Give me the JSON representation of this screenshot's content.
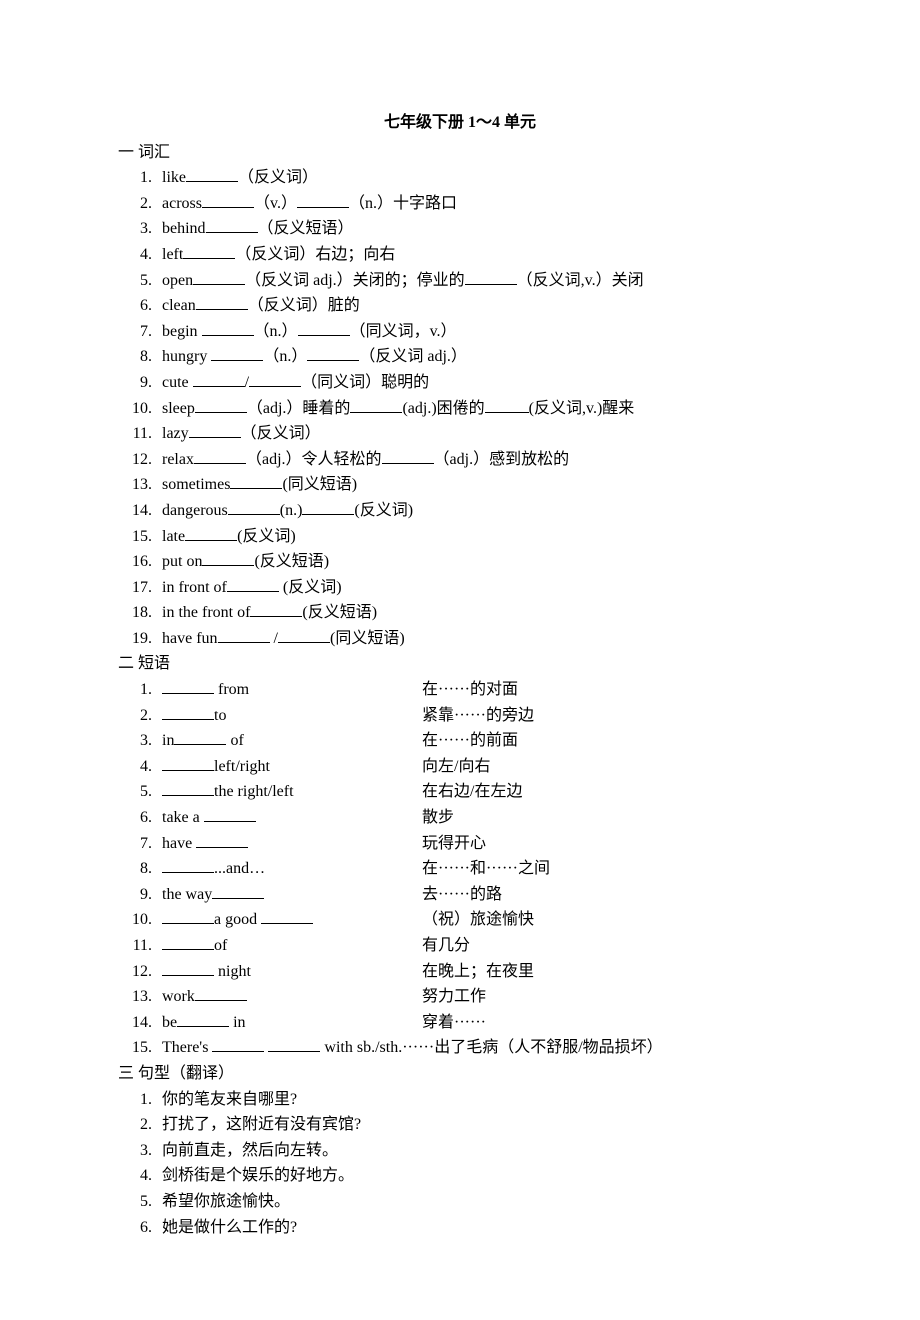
{
  "title": "七年级下册 1～4 单元",
  "sections": {
    "vocab": {
      "head": "一  词汇",
      "items": [
        {
          "pre": "like",
          "rest": "（反义词）"
        },
        {
          "pre": "across",
          "rest": "（v.）",
          "rest2": "（n.）十字路口"
        },
        {
          "pre": "behind",
          "rest": "（反义短语）"
        },
        {
          "pre": "left",
          "rest": "（反义词）右边；向右"
        },
        {
          "pre": "open",
          "rest": "（反义词 adj.）关闭的；停业的",
          "rest2": "（反义词,v.）关闭"
        },
        {
          "pre": "clean",
          "rest": "（反义词）脏的"
        },
        {
          "pre": "begin ",
          "rest": "（n.）",
          "rest2": "（同义词，v.）"
        },
        {
          "pre": "hungry ",
          "rest": "（n.）",
          "rest2": "（反义词 adj.）"
        },
        {
          "pre": "cute ",
          "rest": "/",
          "rest2": "（同义词）聪明的"
        },
        {
          "pre": "sleep",
          "rest": "（adj.）睡着的",
          "rest2": "(adj.)困倦的",
          "rest3": "(反义词,v.)醒来"
        },
        {
          "pre": "lazy",
          "rest": "（反义词）"
        },
        {
          "pre": "relax",
          "rest": "（adj.）令人轻松的",
          "rest2": "（adj.）感到放松的"
        },
        {
          "pre": "sometimes",
          "rest": "(同义短语)"
        },
        {
          "pre": "dangerous",
          "rest": "(n.)",
          "rest2": "(反义词)"
        },
        {
          "pre": "late",
          "rest": "(反义词)"
        },
        {
          "pre": "put on",
          "rest": "(反义短语)"
        },
        {
          "pre": "in front of",
          "rest": " (反义词)"
        },
        {
          "pre": "in the front of",
          "rest": "(反义短语)"
        },
        {
          "pre": "have fun",
          "rest": " /",
          "rest2": "(同义短语)"
        }
      ]
    },
    "phrases": {
      "head": "二  短语",
      "items": [
        {
          "left_pre": "",
          "left_post": " from",
          "right": "在······的对面"
        },
        {
          "left_pre": "",
          "left_post": "to",
          "right": "紧靠······的旁边"
        },
        {
          "left_pre": "in",
          "left_post": " of",
          "right": "在······的前面"
        },
        {
          "left_pre": "",
          "left_post": "left/right",
          "right": "向左/向右"
        },
        {
          "left_pre": "",
          "left_post": "the right/left",
          "right": "在右边/在左边"
        },
        {
          "left_pre": "take a ",
          "left_post": "",
          "right": "散步"
        },
        {
          "left_pre": "have ",
          "left_post": "",
          "right": "玩得开心"
        },
        {
          "left_pre": "",
          "left_post": "...and…",
          "right": "在······和······之间"
        },
        {
          "left_pre": "the way",
          "left_post": "",
          "right": "去······的路"
        },
        {
          "left_pre": "",
          "left_post": "a good ",
          "left_post2": "",
          "right": "（祝）旅途愉快"
        },
        {
          "left_pre": "",
          "left_post": "of",
          "right": "有几分"
        },
        {
          "left_pre": "",
          "left_post": " night",
          "right": "在晚上；在夜里"
        },
        {
          "left_pre": "work",
          "left_post": "",
          "right": "努力工作"
        },
        {
          "left_pre": "be",
          "left_post": " in",
          "right": "穿着······"
        },
        {
          "left_pre": "There's ",
          "left_post": " ",
          "left_post2": " with sb./sth. ",
          "right_inline": "······出了毛病（人不舒服/物品损坏）"
        }
      ]
    },
    "sentences": {
      "head": "三  句型（翻译）",
      "items": [
        "你的笔友来自哪里?",
        "打扰了，这附近有没有宾馆?",
        "向前直走，然后向左转。",
        "剑桥街是个娱乐的好地方。",
        "希望你旅途愉快。",
        "她是做什么工作的?"
      ]
    }
  }
}
